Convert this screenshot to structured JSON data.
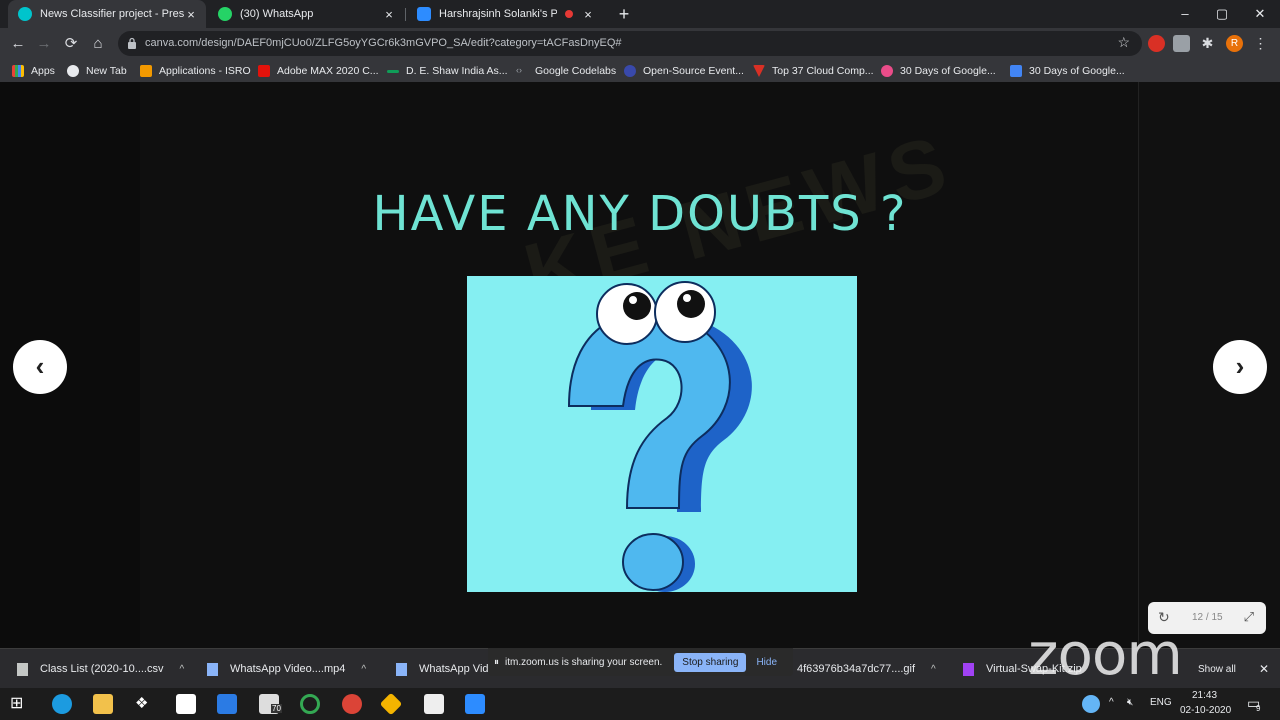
{
  "browser": {
    "tabs": [
      {
        "title": "News Classifier project - Present",
        "active": true
      },
      {
        "title": "(30) WhatsApp",
        "active": false
      },
      {
        "title": "Harshrajsinh Solanki's Person",
        "active": false
      }
    ],
    "url": "canva.com/design/DAEF0mjCUo0/ZLFG5oyYGCr6k3mGVPO_SA/edit?category=tACFasDnyEQ#",
    "profile_initial": "R",
    "bookmarks": [
      "Apps",
      "New Tab",
      "Applications - ISRO",
      "Adobe MAX 2020 C...",
      "D. E. Shaw India As...",
      "Google Codelabs",
      "Open-Source Event...",
      "Top 37 Cloud Comp...",
      "30 Days of Google...",
      "30 Days of Google..."
    ]
  },
  "slide": {
    "watermark": "KE NEWS",
    "title": "HAVE ANY DOUBTS ?",
    "prev_glyph": "‹",
    "next_glyph": "›",
    "counter": "12 / 15"
  },
  "downloads": [
    "Class List (2020-10....csv",
    "WhatsApp Video....mp4",
    "WhatsApp Vid",
    "4f63976b34a7dc77....gif",
    "Virtual-Swap-Kit.zip"
  ],
  "show_all": "Show all",
  "zoom_share": {
    "message": "itm.zoom.us is sharing your screen.",
    "stop": "Stop sharing",
    "hide": "Hide"
  },
  "zoom_logo": "zoom",
  "taskbar": {
    "badge": "70",
    "lang": "ENG",
    "time": "21:43",
    "date": "02-10-2020",
    "notif": "9"
  },
  "colors": {
    "title_teal": "#6fe3d3",
    "qbox_bg": "#85eff2",
    "q_mark": "#4fb8ef",
    "q_shadow": "#1e63c8",
    "zoom_stop": "#8ab4f8"
  }
}
